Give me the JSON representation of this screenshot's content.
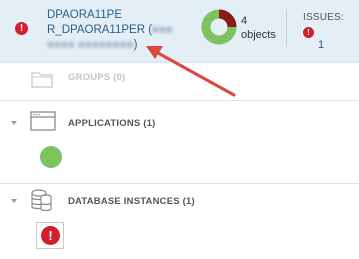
{
  "header": {
    "issue_glyph": "!",
    "system_name_line1": "DPAORA11PE",
    "system_name_line2": "R_DPAORA11PER (",
    "system_name_blurred_tail": "■■■",
    "system_name_line3_blurred": "■■■■ ■■■■■■■■",
    "system_name_line3_end": ")",
    "objects_count": "4",
    "objects_label": "objects",
    "issues_label": "ISSUES:",
    "issues_glyph": "!",
    "issues_count": "1",
    "donut": {
      "green_fraction": 0.75,
      "red_fraction": 0.25,
      "green": "#7dc35e",
      "red": "#8b1a1a"
    }
  },
  "sections": {
    "groups": {
      "label": "GROUPS (0)",
      "icon": "folder-icon"
    },
    "applications": {
      "label": "APPLICATIONS (1)",
      "icon": "window-icon",
      "status_color": "#7dc35e"
    },
    "database_instances": {
      "label": "DATABASE INSTANCES (1)",
      "icon": "database-icon",
      "issue_glyph": "!"
    }
  },
  "colors": {
    "header_bg": "#e3eef7",
    "link": "#2a5f8e",
    "critical": "#d21f2a",
    "arrow": "#d9493d"
  }
}
